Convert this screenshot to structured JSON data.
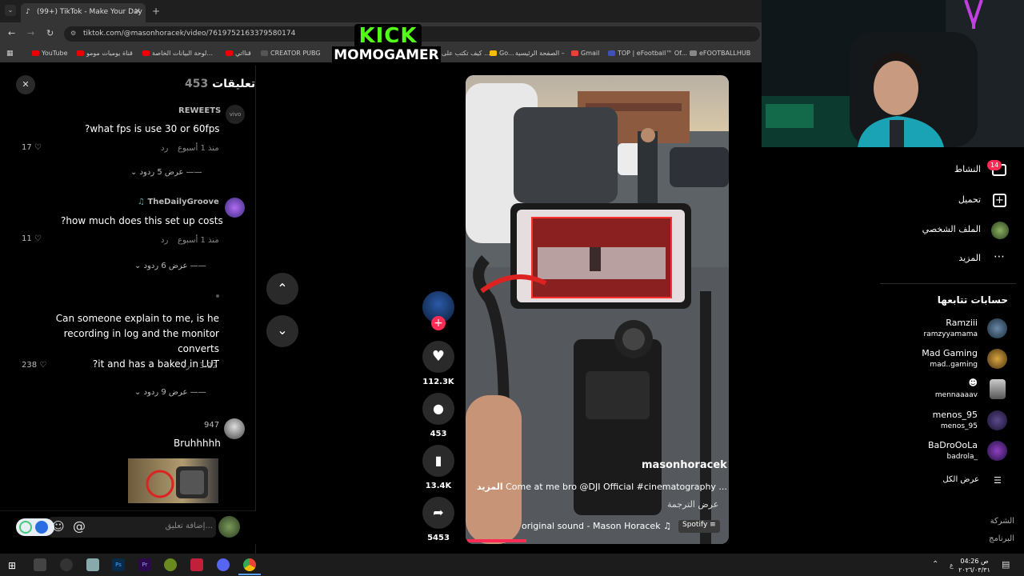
{
  "browser": {
    "tab_title": "(99+) TikTok - Make Your Day",
    "url": "tiktok.com/@masonhoracek/video/7619752163379580174",
    "bookmarks": [
      "YouTube",
      "قناة يوميات مومو",
      "لوحة البيانات الخاصة...",
      "قنااتي",
      "CREATOR PUBG",
      "كيف تكتب على ...",
      "Go...",
      "الصفحة الرئيسية –",
      "Gmail",
      "TOP | eFootball™ Of...",
      "eFOOTBALLHUB"
    ]
  },
  "overlay": {
    "line1": "KICK",
    "line2": "MOMOGAMER"
  },
  "comments": {
    "header_label": "تعليقات",
    "header_count": "453",
    "items": [
      {
        "user": "REWEETS",
        "text": "?what fps is use 30 or 60fps",
        "time": "منذ 1 أسبوع",
        "reply": "رد",
        "likes": "17",
        "replies": "عرض 5 ردود"
      },
      {
        "user": "TheDailyGroove",
        "text": "?how much does this set up costs",
        "time": "منذ 1 أسبوع",
        "reply": "رد",
        "likes": "11",
        "replies": "عرض 6 ردود"
      },
      {
        "user": "",
        "text_lines": [
          "Can someone explain to me, is he",
          "recording in log and the monitor converts",
          "?it and has a baked in LUT"
        ],
        "time": "3-22",
        "reply": "رد",
        "likes": "238",
        "replies": "عرض 9 ردود"
      },
      {
        "user": "947",
        "text": "Bruhhhhh"
      }
    ],
    "input_placeholder": "إضافة تعليق..."
  },
  "video": {
    "author": "masonhoracek",
    "caption": "Come at me bro @DJI Official #cinematography ...",
    "more": "المزيد",
    "translate": "عرض الترجمة",
    "sound": "original sound - Mason Horacek",
    "spotify": "Spotify"
  },
  "actions": {
    "likes": "112.3K",
    "comments": "453",
    "saves": "13.4K",
    "shares": "5453"
  },
  "sidebar": {
    "nav": [
      {
        "label": "النشاط",
        "badge": "14"
      },
      {
        "label": "تحميل"
      },
      {
        "label": "الملف الشخصي"
      },
      {
        "label": "المزيد"
      }
    ],
    "following_title": "حسابات تتابعها",
    "following": [
      {
        "name": "Ramziii",
        "handle": "ramzyyamama"
      },
      {
        "name": "Mad Gaming",
        "handle": "mad..gaming"
      },
      {
        "name": "",
        "handle": "mennaaaav"
      },
      {
        "name": "menos_95",
        "handle": "menos_95"
      },
      {
        "name": "BaDroOoLa",
        "handle": "badrola_"
      }
    ],
    "see_all": "عرض الكل",
    "footer1": "الشركة",
    "footer2": "البرنامج"
  },
  "taskbar": {
    "time": "04:26 ص",
    "date": "٢٠٢٦/٠٣/٣١"
  },
  "colors": {
    "accent": "#fe2c55",
    "kick_green": "#53fc18"
  }
}
